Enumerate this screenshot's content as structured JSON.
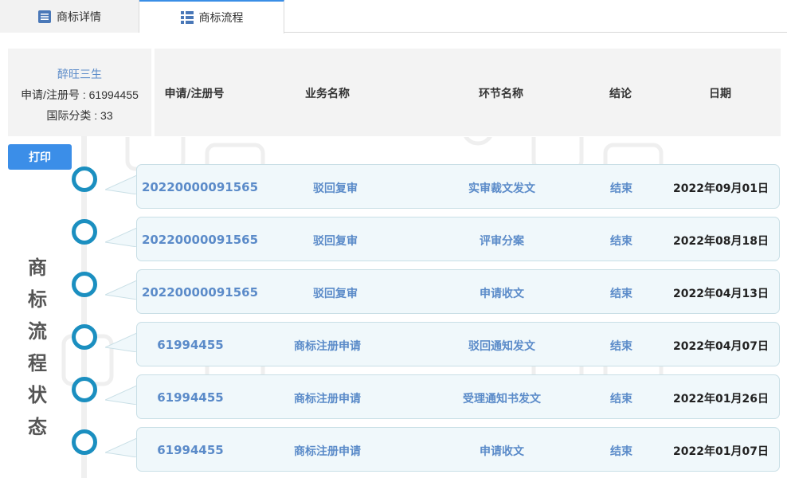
{
  "tabs": [
    {
      "label": "商标详情",
      "icon": "document-list-icon"
    },
    {
      "label": "商标流程",
      "icon": "grid-icon"
    }
  ],
  "info": {
    "name": "醉旺三生",
    "reg_number_line": "申请/注册号 : 61994455",
    "class_line": "国际分类 : 33"
  },
  "headers": {
    "reg_no": "申请/注册号",
    "business": "业务名称",
    "step": "环节名称",
    "conclusion": "结论",
    "date": "日期"
  },
  "print_label": "打印",
  "vertical_title": [
    "商",
    "标",
    "流",
    "程",
    "状",
    "态"
  ],
  "rows": [
    {
      "reg_no": "20220000091565",
      "business": "驳回复审",
      "step": "实审裁文发文",
      "conclusion": "结束",
      "date": "2022年09月01日"
    },
    {
      "reg_no": "20220000091565",
      "business": "驳回复审",
      "step": "评审分案",
      "conclusion": "结束",
      "date": "2022年08月18日"
    },
    {
      "reg_no": "20220000091565",
      "business": "驳回复审",
      "step": "申请收文",
      "conclusion": "结束",
      "date": "2022年04月13日"
    },
    {
      "reg_no": "61994455",
      "business": "商标注册申请",
      "step": "驳回通知发文",
      "conclusion": "结束",
      "date": "2022年04月07日"
    },
    {
      "reg_no": "61994455",
      "business": "商标注册申请",
      "step": "受理通知书发文",
      "conclusion": "结束",
      "date": "2022年01月26日"
    },
    {
      "reg_no": "61994455",
      "business": "商标注册申请",
      "step": "申请收文",
      "conclusion": "结束",
      "date": "2022年01月07日"
    }
  ],
  "colors": {
    "accent": "#3b8ee8",
    "timeline_circle": "#1b8fc0",
    "link_text": "#5b8bc9",
    "bubble_bg": "#f0f8fb"
  }
}
